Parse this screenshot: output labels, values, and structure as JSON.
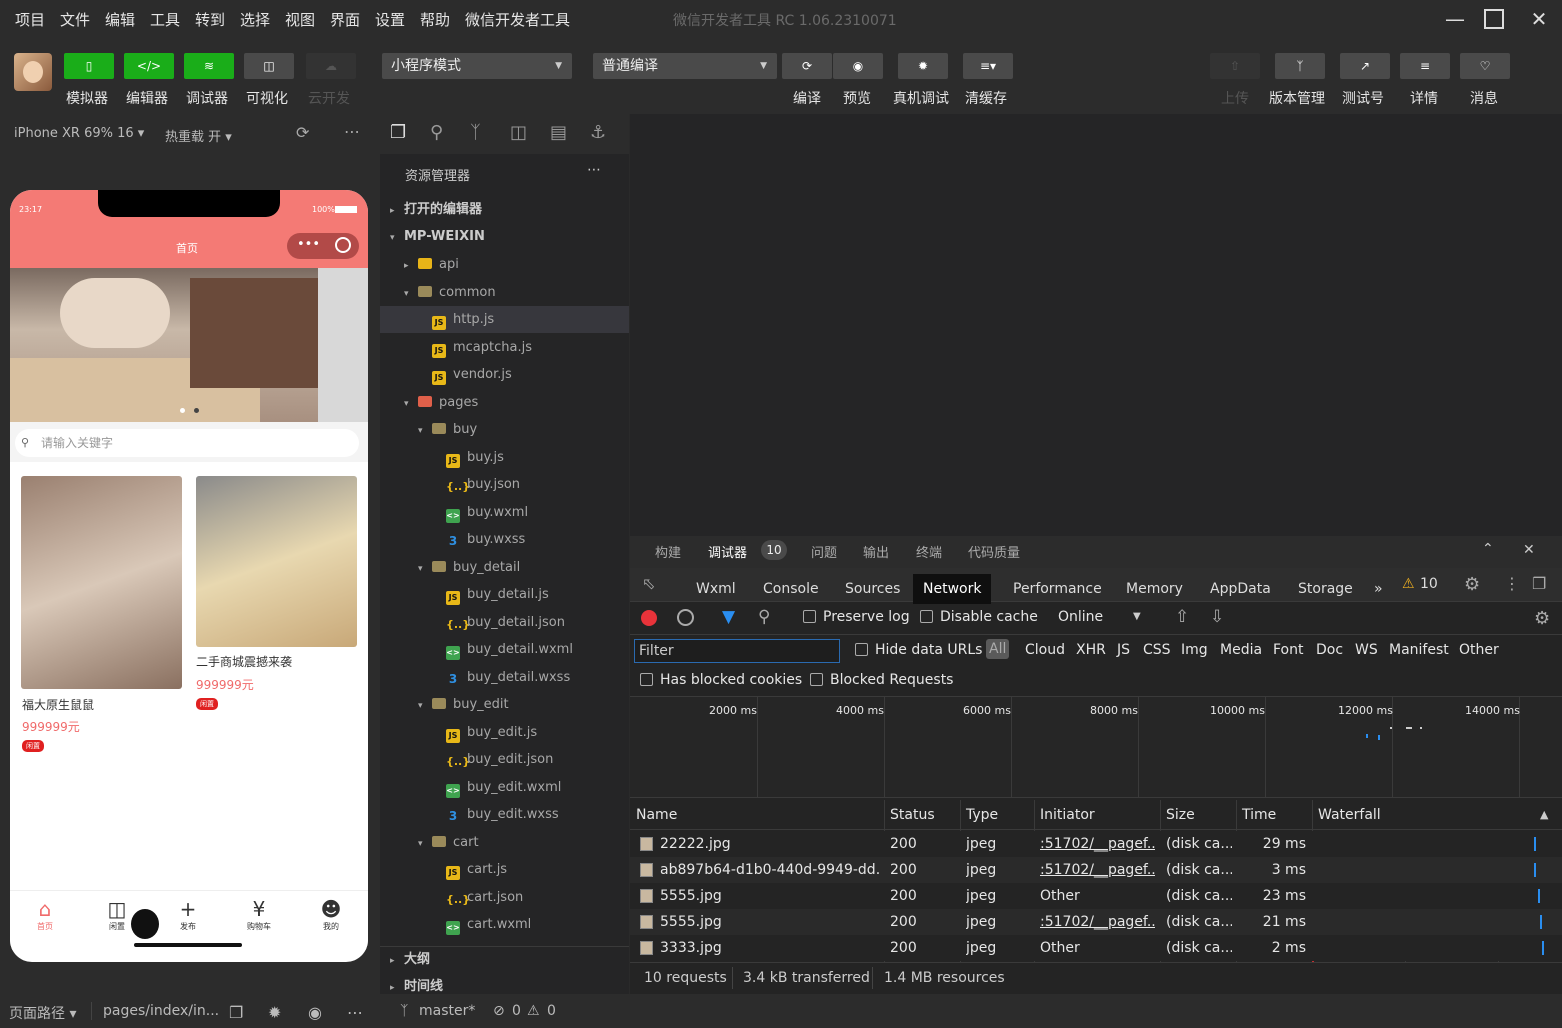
{
  "menubar": {
    "items": [
      "项目",
      "文件",
      "编辑",
      "工具",
      "转到",
      "选择",
      "视图",
      "界面",
      "设置",
      "帮助",
      "微信开发者工具"
    ],
    "title": "微信开发者工具 RC 1.06.2310071"
  },
  "toolbar": {
    "simulator": "模拟器",
    "editor": "编辑器",
    "debugger": "调试器",
    "visual": "可视化",
    "cloud": "云开发",
    "mode": "小程序模式",
    "compile_mode": "普通编译",
    "compile": "编译",
    "preview": "预览",
    "real_debug": "真机调试",
    "clear_cache": "清缓存",
    "upload": "上传",
    "version": "版本管理",
    "test_account": "测试号",
    "details": "详情",
    "messages": "消息"
  },
  "simulator": {
    "device": "iPhone XR 69% 16",
    "hot_reload": "热重载 开",
    "time": "23:17",
    "battery": "100%",
    "nav_title": "首页",
    "search_placeholder": "请输入关键字",
    "products": [
      {
        "name": "福大原生鼠鼠",
        "price": "999999元",
        "tag": "闲置"
      },
      {
        "name": "二手商城震撼来袭",
        "price": "999999元",
        "tag": "闲置"
      }
    ],
    "tabs": [
      "首页",
      "闲置",
      "发布",
      "购物车",
      "我的"
    ]
  },
  "explorer": {
    "title": "资源管理器",
    "open_editors": "打开的编辑器",
    "root": "MP-WEIXIN",
    "outline": "大纲",
    "timeline": "时间线",
    "tree": [
      {
        "label": "api",
        "type": "folder-y",
        "depth": 1,
        "arrow": "▸"
      },
      {
        "label": "common",
        "type": "folder",
        "depth": 1,
        "arrow": "▾"
      },
      {
        "label": "http.js",
        "type": "js",
        "depth": 2,
        "arrow": ""
      },
      {
        "label": "mcaptcha.js",
        "type": "js",
        "depth": 2,
        "arrow": ""
      },
      {
        "label": "vendor.js",
        "type": "js",
        "depth": 2,
        "arrow": ""
      },
      {
        "label": "pages",
        "type": "folder-r",
        "depth": 1,
        "arrow": "▾"
      },
      {
        "label": "buy",
        "type": "folder",
        "depth": 2,
        "arrow": "▾"
      },
      {
        "label": "buy.js",
        "type": "js",
        "depth": 3,
        "arrow": ""
      },
      {
        "label": "buy.json",
        "type": "json",
        "depth": 3,
        "arrow": ""
      },
      {
        "label": "buy.wxml",
        "type": "wxml",
        "depth": 3,
        "arrow": ""
      },
      {
        "label": "buy.wxss",
        "type": "wxss",
        "depth": 3,
        "arrow": ""
      },
      {
        "label": "buy_detail",
        "type": "folder",
        "depth": 2,
        "arrow": "▾"
      },
      {
        "label": "buy_detail.js",
        "type": "js",
        "depth": 3,
        "arrow": ""
      },
      {
        "label": "buy_detail.json",
        "type": "json",
        "depth": 3,
        "arrow": ""
      },
      {
        "label": "buy_detail.wxml",
        "type": "wxml",
        "depth": 3,
        "arrow": ""
      },
      {
        "label": "buy_detail.wxss",
        "type": "wxss",
        "depth": 3,
        "arrow": ""
      },
      {
        "label": "buy_edit",
        "type": "folder",
        "depth": 2,
        "arrow": "▾"
      },
      {
        "label": "buy_edit.js",
        "type": "js",
        "depth": 3,
        "arrow": ""
      },
      {
        "label": "buy_edit.json",
        "type": "json",
        "depth": 3,
        "arrow": ""
      },
      {
        "label": "buy_edit.wxml",
        "type": "wxml",
        "depth": 3,
        "arrow": ""
      },
      {
        "label": "buy_edit.wxss",
        "type": "wxss",
        "depth": 3,
        "arrow": ""
      },
      {
        "label": "cart",
        "type": "folder",
        "depth": 2,
        "arrow": "▾"
      },
      {
        "label": "cart.js",
        "type": "js",
        "depth": 3,
        "arrow": ""
      },
      {
        "label": "cart.json",
        "type": "json",
        "depth": 3,
        "arrow": ""
      },
      {
        "label": "cart.wxml",
        "type": "wxml",
        "depth": 3,
        "arrow": ""
      }
    ]
  },
  "devtools": {
    "top_tabs": [
      "构建",
      "调试器",
      "问题",
      "输出",
      "终端",
      "代码质量"
    ],
    "debugger_badge": "10",
    "tabs": [
      "Wxml",
      "Console",
      "Sources",
      "Network",
      "Performance",
      "Memory",
      "AppData",
      "Storage"
    ],
    "active_tab": "Network",
    "more": "»",
    "warning_count": "10",
    "preserve_log": "Preserve log",
    "disable_cache": "Disable cache",
    "throttle": "Online",
    "filter_placeholder": "Filter",
    "hide_data_urls": "Hide data URLs",
    "filter_types": [
      "All",
      "Cloud",
      "XHR",
      "JS",
      "CSS",
      "Img",
      "Media",
      "Font",
      "Doc",
      "WS",
      "Manifest",
      "Other"
    ],
    "has_blocked_cookies": "Has blocked cookies",
    "blocked_requests": "Blocked Requests",
    "timeline_ticks": [
      "2000 ms",
      "4000 ms",
      "6000 ms",
      "8000 ms",
      "10000 ms",
      "12000 ms",
      "14000 ms"
    ],
    "columns": [
      "Name",
      "Status",
      "Type",
      "Initiator",
      "Size",
      "Time",
      "Waterfall"
    ],
    "rows": [
      {
        "name": "22222.jpg",
        "status": "200",
        "type": "jpeg",
        "initiator": ":51702/__pagef...",
        "initiator_link": true,
        "size": "(disk ca...",
        "time": "29 ms"
      },
      {
        "name": "ab897b64-d1b0-440d-9949-dd...",
        "status": "200",
        "type": "jpeg",
        "initiator": ":51702/__pagef...",
        "initiator_link": true,
        "size": "(disk ca...",
        "time": "3 ms"
      },
      {
        "name": "5555.jpg",
        "status": "200",
        "type": "jpeg",
        "initiator": "Other",
        "initiator_link": false,
        "size": "(disk ca...",
        "time": "23 ms"
      },
      {
        "name": "5555.jpg",
        "status": "200",
        "type": "jpeg",
        "initiator": ":51702/__pagef...",
        "initiator_link": true,
        "size": "(disk ca...",
        "time": "21 ms"
      },
      {
        "name": "3333.jpg",
        "status": "200",
        "type": "jpeg",
        "initiator": "Other",
        "initiator_link": false,
        "size": "(disk ca...",
        "time": "2 ms"
      }
    ],
    "summary": {
      "requests": "10 requests",
      "transferred": "3.4 kB transferred",
      "resources": "1.4 MB resources"
    }
  },
  "statusbar": {
    "page_path_label": "页面路径",
    "page_path": "pages/index/in...",
    "branch": "master*",
    "errors": "0",
    "warnings": "0"
  }
}
